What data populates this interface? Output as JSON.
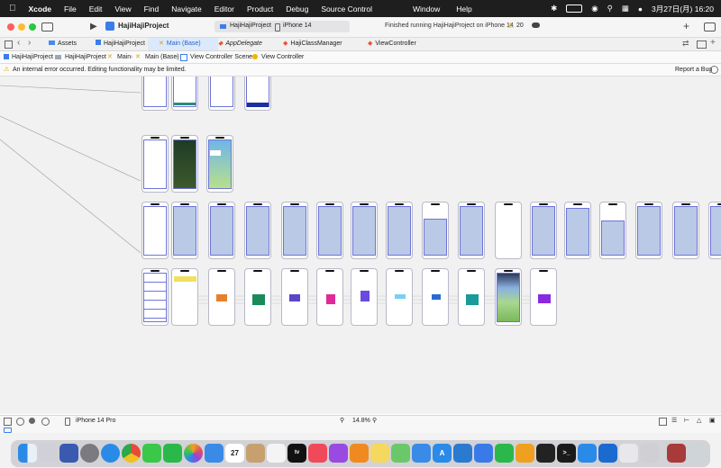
{
  "menubar": {
    "apple_icon": "apple-logo",
    "app_name": "Xcode",
    "items": [
      "File",
      "Edit",
      "View",
      "Find",
      "Navigate",
      "Editor",
      "Product",
      "Debug",
      "Source Control"
    ],
    "right_items": [
      "Window",
      "Help"
    ],
    "datetime": "3月27日(月)  16:20"
  },
  "toolbar": {
    "project_title": "HajiHajiProject",
    "scheme": "HajiHajiProject",
    "device": "iPhone 14",
    "status": "Finished running HajiHajiProject on iPhone 14",
    "warning_count": "20"
  },
  "tabs": [
    {
      "label": "Assets"
    },
    {
      "label": "HajiHajiProject"
    },
    {
      "label": "Main (Base)"
    },
    {
      "label": "AppDelegate"
    },
    {
      "label": "HajiClassManager"
    },
    {
      "label": "ViewController"
    }
  ],
  "jumpbar": {
    "crumbs": [
      "HajiHajiProject",
      "HajiHajiProject",
      "Main",
      "Main (Base)",
      "View Controller Scene",
      "View Controller"
    ]
  },
  "warning": {
    "message": "An internal error occurred. Editing functionality may be limited.",
    "report_label": "Report a Bug"
  },
  "bottombar": {
    "device": "iPhone 14 Pro",
    "zoom": "14.8%"
  },
  "colors": {
    "accent": "#2a64c8",
    "phone_blue": "#b9c9e6",
    "border_blue": "#6d74d8"
  }
}
